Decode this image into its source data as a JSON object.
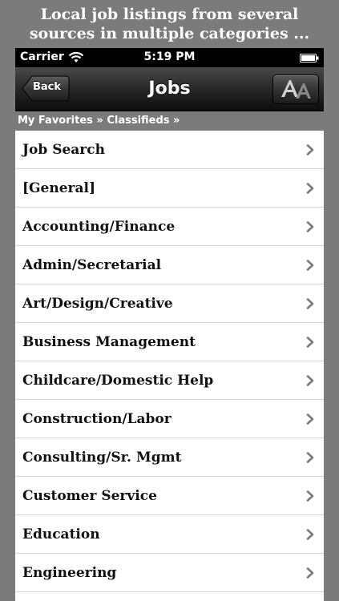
{
  "promo": {
    "line1": "Local job listings from several",
    "line2": "sources in multiple categories ..."
  },
  "status_bar": {
    "carrier": "Carrier",
    "time": "5:19 PM",
    "wifi_icon": "wifi-icon",
    "battery_icon": "battery-icon"
  },
  "nav": {
    "back_label": "Back",
    "title": "Jobs",
    "font_size_icon": "font-size-icon"
  },
  "breadcrumb": {
    "item1": "My Favorites",
    "sep1": " » ",
    "item2": "Classifieds",
    "sep2": " »"
  },
  "categories": [
    {
      "label": "Job Search"
    },
    {
      "label": "[General]"
    },
    {
      "label": "Accounting/Finance"
    },
    {
      "label": "Admin/Secretarial"
    },
    {
      "label": "Art/Design/Creative"
    },
    {
      "label": "Business Management"
    },
    {
      "label": "Childcare/Domestic Help"
    },
    {
      "label": "Construction/Labor"
    },
    {
      "label": "Consulting/Sr. Mgmt"
    },
    {
      "label": "Customer Service"
    },
    {
      "label": "Education"
    },
    {
      "label": "Engineering"
    }
  ],
  "colors": {
    "background": "#7b7b7b",
    "navbar": "#1a1a1a",
    "row_text": "#111111",
    "chevron": "#7a7a7a"
  }
}
